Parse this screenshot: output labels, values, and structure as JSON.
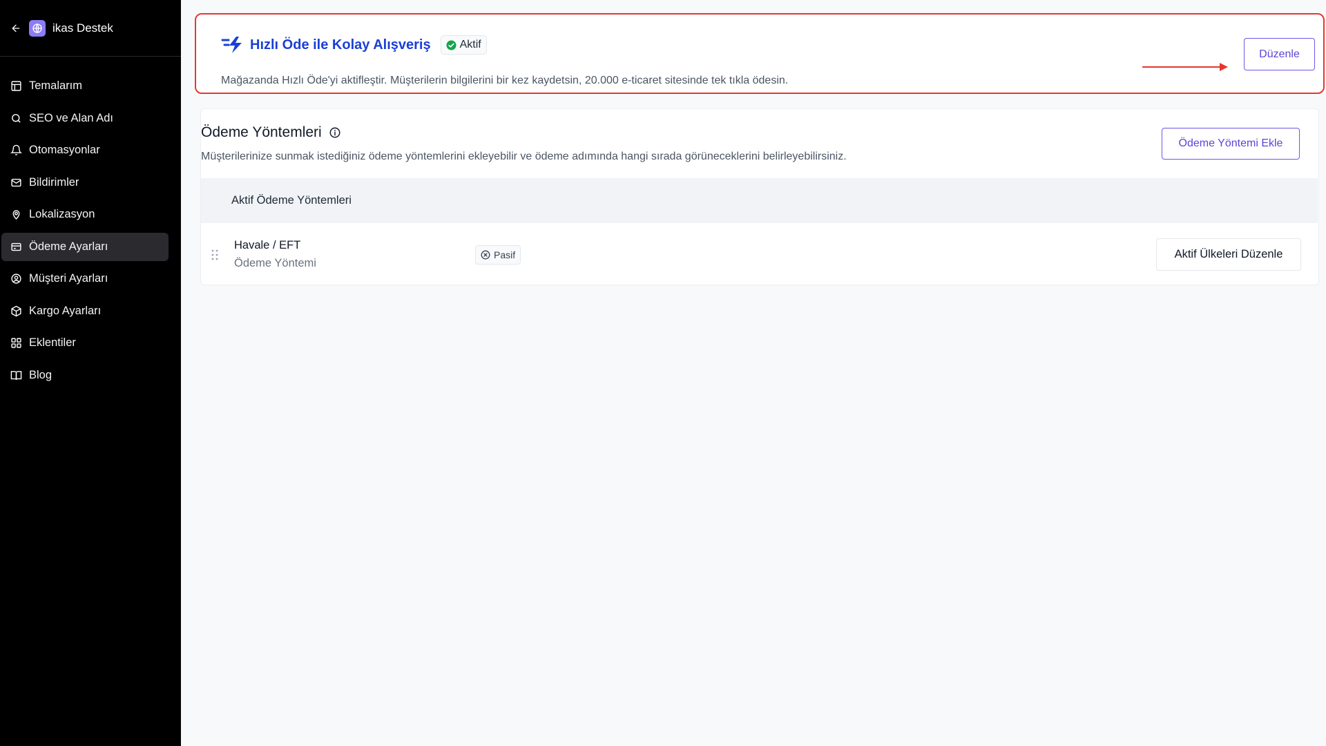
{
  "sidebar": {
    "title": "ikas Destek",
    "items": [
      {
        "label": "Temalarım",
        "icon": "layout-icon"
      },
      {
        "label": "SEO ve Alan Adı",
        "icon": "search-icon"
      },
      {
        "label": "Otomasyonlar",
        "icon": "bell-icon"
      },
      {
        "label": "Bildirimler",
        "icon": "mail-icon"
      },
      {
        "label": "Lokalizasyon",
        "icon": "map-pin-icon"
      },
      {
        "label": "Ödeme Ayarları",
        "icon": "credit-card-icon",
        "active": true
      },
      {
        "label": "Müşteri Ayarları",
        "icon": "user-circle-icon"
      },
      {
        "label": "Kargo Ayarları",
        "icon": "package-icon"
      },
      {
        "label": "Eklentiler",
        "icon": "grid-icon"
      },
      {
        "label": "Blog",
        "icon": "book-icon"
      }
    ]
  },
  "promo": {
    "title": "Hızlı Öde ile Kolay Alışveriş",
    "status": "Aktif",
    "description": "Mağazanda Hızlı Öde'yi aktifleştir. Müşterilerin bilgilerini bir kez kaydetsin, 20.000 e-ticaret sitesinde tek tıkla ödesin.",
    "button": "Düzenle"
  },
  "payment_methods": {
    "title": "Ödeme Yöntemleri",
    "description": "Müşterilerinize sunmak istediğiniz ödeme yöntemlerini ekleyebilir ve ödeme adımında hangi sırada görüneceklerini belirleyebilirsiniz.",
    "add_button": "Ödeme Yöntemi Ekle",
    "subheader": "Aktif Ödeme Yöntemleri",
    "rows": [
      {
        "name": "Havale / EFT",
        "type": "Ödeme Yöntemi",
        "status": "Pasif",
        "action": "Aktif Ülkeleri Düzenle"
      }
    ]
  },
  "colors": {
    "accent": "#5b45d8",
    "promo_title": "#1a3fd6",
    "highlight": "#e5372d",
    "status_active": "#16a34a"
  }
}
